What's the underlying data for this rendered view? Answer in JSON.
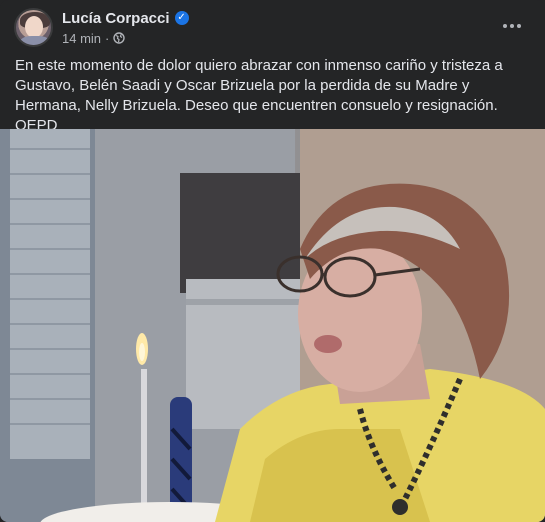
{
  "post": {
    "author": "Lucía Corpacci",
    "time": "14 min",
    "time_separator": "·",
    "privacy_icon": "globe-icon",
    "verified_icon": "verified-badge-icon",
    "more_icon": "more-options-icon",
    "more_glyph": "···",
    "text": "En este momento de dolor quiero abrazar con inmenso cariño y tristeza a Gustavo, Belén Saadi y Oscar Brizuela por la perdida de su Madre y Hermana, Nelly Brizuela. Deseo que encuentren consuelo y resignación. QEPD"
  },
  "colors": {
    "background": "#242526",
    "text_primary": "#e4e6eb",
    "text_secondary": "#b0b3b8",
    "verified_blue": "#1b74e4"
  }
}
